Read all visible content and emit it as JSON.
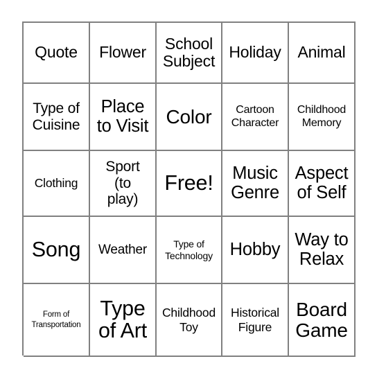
{
  "card": {
    "type": "bingo-card",
    "rows": 5,
    "columns": 5,
    "free_space_label": "Free!",
    "free_space_position": {
      "row": 3,
      "column": 3
    },
    "border_color": "#808080",
    "background_color": "#ffffff",
    "text_color": "#000000",
    "cells": [
      {
        "text": "Quote",
        "size": "fs-xl"
      },
      {
        "text": "Flower",
        "size": "fs-xl"
      },
      {
        "text": "School\nSubject",
        "size": "fs-xl"
      },
      {
        "text": "Holiday",
        "size": "fs-xl"
      },
      {
        "text": "Animal",
        "size": "fs-xl"
      },
      {
        "text": "Type of\nCuisine",
        "size": "fs-l"
      },
      {
        "text": "Place\nto Visit",
        "size": "fs-xxl"
      },
      {
        "text": "Color",
        "size": "fs-3xl"
      },
      {
        "text": "Cartoon\nCharacter",
        "size": "fs-s"
      },
      {
        "text": "Childhood\nMemory",
        "size": "fs-s"
      },
      {
        "text": "Clothing",
        "size": "fs-m"
      },
      {
        "text": "Sport\n(to\nplay)",
        "size": "fs-l"
      },
      {
        "text": "Free!",
        "size": "fs-4xl"
      },
      {
        "text": "Music\nGenre",
        "size": "fs-xxl"
      },
      {
        "text": "Aspect\nof Self",
        "size": "fs-xxl"
      },
      {
        "text": "Song",
        "size": "fs-4xl"
      },
      {
        "text": "Weather",
        "size": "fs-ml"
      },
      {
        "text": "Type of\nTechnology",
        "size": "fs-xs"
      },
      {
        "text": "Hobby",
        "size": "fs-xxl"
      },
      {
        "text": "Way to\nRelax",
        "size": "fs-xxl"
      },
      {
        "text": "Form of\nTransportation",
        "size": "fs-xxs"
      },
      {
        "text": "Type\nof Art",
        "size": "fs-4xl"
      },
      {
        "text": "Childhood\nToy",
        "size": "fs-m"
      },
      {
        "text": "Historical\nFigure",
        "size": "fs-m"
      },
      {
        "text": "Board\nGame",
        "size": "fs-3xl"
      }
    ]
  }
}
